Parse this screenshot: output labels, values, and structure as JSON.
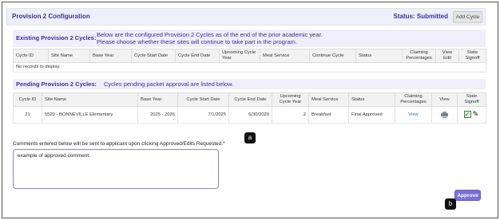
{
  "header": {
    "title": "Provision 2 Configuration",
    "status": "Status: Submitted",
    "add_cycle_label": "Add Cycle"
  },
  "existing": {
    "label": "Existing Provision 2 Cycles:",
    "description_line1": "Below are the configured Provision 2 Cycles as of the end of the prior academic year.",
    "description_line2": "Please choose whether these sites will continue to take part in the program.",
    "columns": [
      "Cycle ID",
      "Site Name",
      "Base Year",
      "Cycle Start Date",
      "Cycle End Date",
      "Upcoming Cycle Year",
      "Meal Service",
      "Continue Cycle",
      "Status",
      "Claiming Percentages",
      "View Edit",
      "State Signoff"
    ],
    "empty_text": "No records to display."
  },
  "pending": {
    "label": "Pending Provision 2 Cycles:",
    "description": "Cycles pending packet approval are listed below.",
    "columns": [
      "Cycle ID",
      "Site Name",
      "Base Year",
      "Cycle Start Date",
      "Cycle End Date",
      "Upcoming Cycle Year",
      "Meal Service",
      "Status",
      "Claiming Percentages",
      "View",
      "State Signoff"
    ],
    "rows": [
      {
        "cycle_id": "21",
        "site_name": "5520 - BONNEVILLE Elementary",
        "base_year": "2025 - 2026",
        "start_date": "7/1/2025",
        "end_date": "6/30/2029",
        "upcoming_year": "2",
        "meal_service": "Breakfast",
        "status": "Final Approved",
        "claiming_link": "View"
      }
    ]
  },
  "comments": {
    "label": "Comments entered below will be sent to applicant upon clicking Approved/Edits Requested.",
    "required_mark": "*",
    "value": "example of approved comment"
  },
  "callouts": {
    "a": "a",
    "b": "b"
  },
  "approve_label": "Approve",
  "colors": {
    "accent": "#3b2e9a",
    "approve": "#7b6fd9",
    "link": "#3a63c7"
  }
}
